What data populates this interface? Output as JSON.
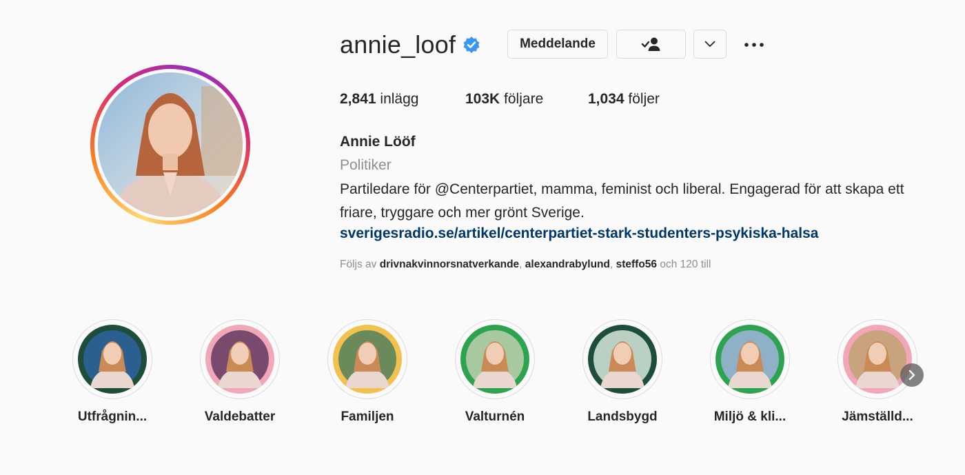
{
  "profile": {
    "username": "annie_loof",
    "verified": true,
    "full_name": "Annie Lööf",
    "category": "Politiker",
    "bio": "Partiledare för @Centerpartiet, mamma, feminist och liberal. Engagerad för att skapa ett friare, tryggare och mer grönt Sverige.",
    "link": "sverigesradio.se/artikel/centerpartiet-stark-studenters-psykiska-halsa"
  },
  "actions": {
    "message_label": "Meddelande",
    "follow_icon": "following-check-user-icon",
    "dropdown_icon": "chevron-down-icon",
    "more_icon": "more-dots-icon"
  },
  "stats": {
    "posts_count": "2,841",
    "posts_label": "inlägg",
    "followers_count": "103K",
    "followers_label": "följare",
    "following_count": "1,034",
    "following_label": "följer"
  },
  "followed_by": {
    "prefix": "Följs av",
    "users": [
      "drivnakvinnorsnatverkande",
      "alexandrabylund",
      "steffo56"
    ],
    "separator": ",",
    "suffix": "och 120 till"
  },
  "highlights": [
    {
      "label": "Utfrågnin...",
      "ring_color": "#1e4d3a",
      "bg_color": "#2a5f8f"
    },
    {
      "label": "Valdebatter",
      "ring_color": "#f0a8b8",
      "bg_color": "#7a4a6e"
    },
    {
      "label": "Familjen",
      "ring_color": "#f2c14e",
      "bg_color": "#6b8a5a"
    },
    {
      "label": "Valturnén",
      "ring_color": "#2ea34f",
      "bg_color": "#a8c9a0"
    },
    {
      "label": "Landsbygd",
      "ring_color": "#1e4d3a",
      "bg_color": "#b9d0c2"
    },
    {
      "label": "Miljö & kli...",
      "ring_color": "#2ea34f",
      "bg_color": "#8fb1c8"
    },
    {
      "label": "Jämställd...",
      "ring_color": "#f0a8b8",
      "bg_color": "#c9a27e"
    }
  ],
  "colors": {
    "verified_blue": "#3897f0",
    "link_blue": "#00376b",
    "muted_gray": "#8e8e8e",
    "story_gradient": [
      "#feda75",
      "#fa7e1e",
      "#d62976",
      "#962fbf"
    ]
  }
}
